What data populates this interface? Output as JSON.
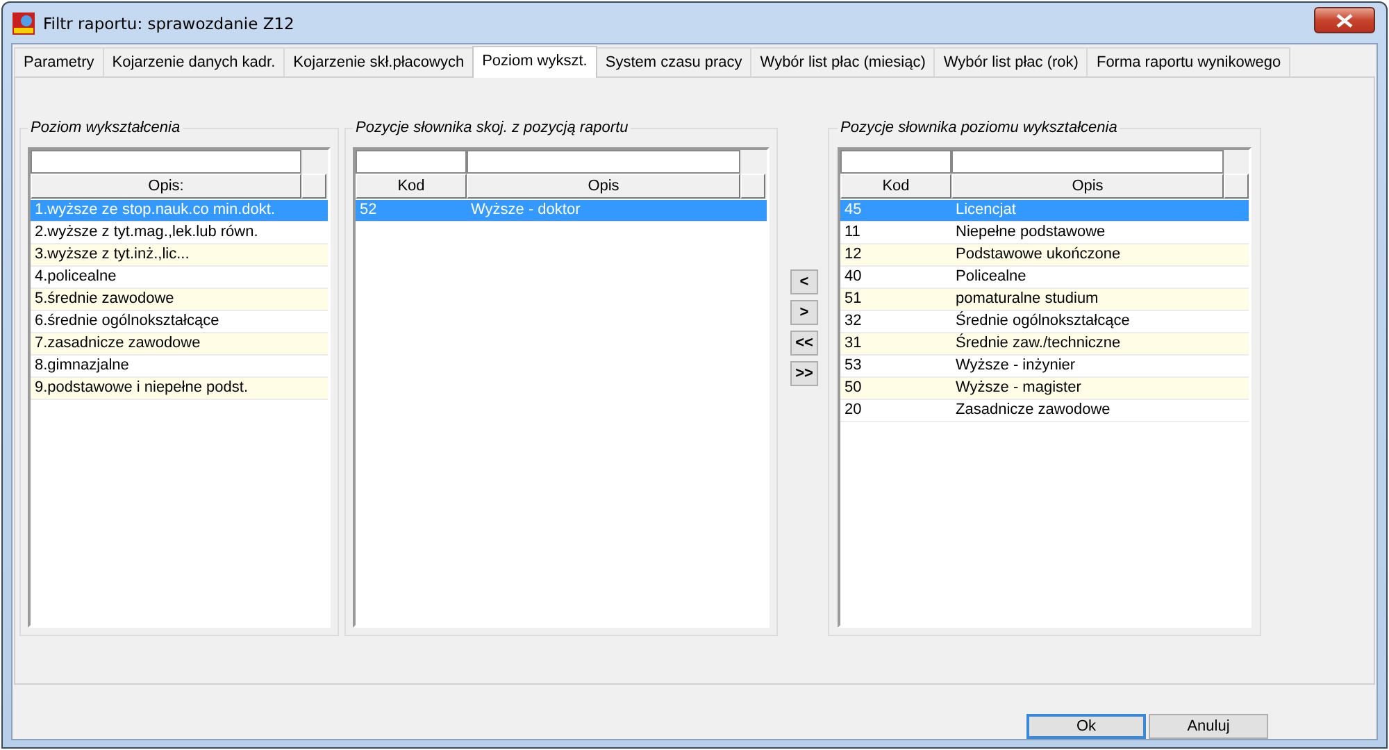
{
  "window": {
    "title": "Filtr raportu: sprawozdanie Z12"
  },
  "tabs": [
    {
      "label": "Parametry",
      "selected": false
    },
    {
      "label": "Kojarzenie danych kadr.",
      "selected": false
    },
    {
      "label": "Kojarzenie skł.płacowych",
      "selected": false
    },
    {
      "label": "Poziom wykszt.",
      "selected": true
    },
    {
      "label": "System czasu pracy",
      "selected": false
    },
    {
      "label": "Wybór list płac (miesiąc)",
      "selected": false
    },
    {
      "label": "Wybór list płac (rok)",
      "selected": false
    },
    {
      "label": "Forma raportu wynikowego",
      "selected": false
    }
  ],
  "groups": [
    {
      "title": "Poziom wykształcenia",
      "columns": [
        "Opis:"
      ],
      "rows": [
        {
          "cells": [
            "1.wyższe ze stop.nauk.co min.dokt."
          ],
          "selected": true
        },
        {
          "cells": [
            "2.wyższe z tyt.mag.,lek.lub równ."
          ],
          "selected": false
        },
        {
          "cells": [
            "3.wyższe z tyt.inż.,lic..."
          ],
          "selected": false
        },
        {
          "cells": [
            "4.policealne"
          ],
          "selected": false
        },
        {
          "cells": [
            "5.średnie zawodowe"
          ],
          "selected": false
        },
        {
          "cells": [
            "6.średnie ogólnokształcące"
          ],
          "selected": false
        },
        {
          "cells": [
            "7.zasadnicze zawodowe"
          ],
          "selected": false
        },
        {
          "cells": [
            "8.gimnazjalne"
          ],
          "selected": false
        },
        {
          "cells": [
            "9.podstawowe i niepełne podst."
          ],
          "selected": false
        }
      ]
    },
    {
      "title": "Pozycje słownika skoj. z pozycją raportu",
      "columns": [
        "Kod",
        "Opis"
      ],
      "rows": [
        {
          "cells": [
            "52",
            "Wyższe - doktor"
          ],
          "selected": true
        }
      ]
    },
    {
      "title": "Pozycje słownika poziomu wykształcenia",
      "columns": [
        "Kod",
        "Opis"
      ],
      "rows": [
        {
          "cells": [
            "45",
            "Licencjat"
          ],
          "selected": true
        },
        {
          "cells": [
            "11",
            "Niepełne podstawowe"
          ],
          "selected": false
        },
        {
          "cells": [
            "12",
            "Podstawowe ukończone"
          ],
          "selected": false
        },
        {
          "cells": [
            "40",
            "Policealne"
          ],
          "selected": false
        },
        {
          "cells": [
            "51",
            "pomaturalne studium"
          ],
          "selected": false
        },
        {
          "cells": [
            "32",
            "Średnie ogólnokształcące"
          ],
          "selected": false
        },
        {
          "cells": [
            "31",
            "Średnie zaw./techniczne"
          ],
          "selected": false
        },
        {
          "cells": [
            "53",
            "Wyższe - inżynier"
          ],
          "selected": false
        },
        {
          "cells": [
            "50",
            "Wyższe - magister"
          ],
          "selected": false
        },
        {
          "cells": [
            "20",
            "Zasadnicze zawodowe"
          ],
          "selected": false
        }
      ]
    }
  ],
  "move_buttons": [
    "<",
    ">",
    "<<",
    ">>"
  ],
  "buttons": [
    {
      "label": "Ok",
      "default": true
    },
    {
      "label": "Anuluj",
      "default": false
    }
  ]
}
